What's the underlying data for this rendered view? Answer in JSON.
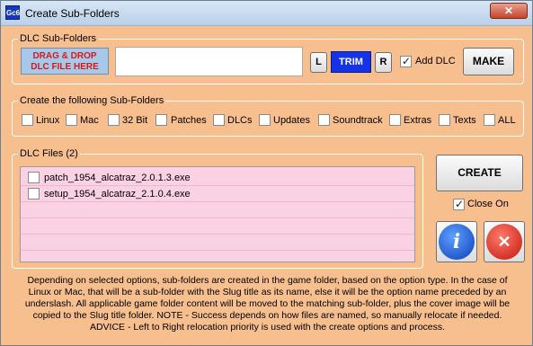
{
  "window": {
    "title": "Create Sub-Folders",
    "icon_text": "Gc6",
    "close_glyph": "✕"
  },
  "dlc_subfolders": {
    "legend": "DLC Sub-Folders",
    "drag_drop_line1": "DRAG & DROP",
    "drag_drop_line2": "DLC FILE HERE",
    "input_value": "",
    "l_label": "L",
    "trim_label": "TRIM",
    "r_label": "R",
    "add_dlc_label": "Add DLC",
    "add_dlc_checked": true,
    "make_label": "MAKE"
  },
  "create_following": {
    "legend": "Create the following Sub-Folders",
    "options": [
      "Linux",
      "Mac",
      "32 Bit",
      "Patches",
      "DLCs",
      "Updates",
      "Soundtrack",
      "Extras",
      "Texts",
      "ALL"
    ]
  },
  "dlc_files": {
    "legend": "DLC Files (2)",
    "files": [
      "patch_1954_alcatraz_2.0.1.3.exe",
      "setup_1954_alcatraz_2.1.0.4.exe"
    ]
  },
  "actions": {
    "create_label": "CREATE",
    "close_on_label": "Close On",
    "close_on_checked": true,
    "info_glyph": "i",
    "cancel_glyph": "✕"
  },
  "footer": {
    "line1": "Depending on selected options, sub-folders are created in the game folder, based on the option type. In the case of",
    "line2": "Linux or Mac, that will be a sub-folder with the Slug title as its name, else it will be the option name preceded by an",
    "line3": "underslash. All applicable game folder content will be moved to the matching sub-folder, plus the cover image will be",
    "line4": "copied to the Slug title folder. NOTE - Success depends on how files are named, so manually relocate if needed.",
    "line5": "ADVICE - Left to Right relocation priority is used with the create options and process."
  },
  "colors": {
    "window_bg": "#f7be8e",
    "trim_bg": "#1432e6",
    "list_bg": "#fbd2e3",
    "drag_drop_text": "#d61a1a"
  }
}
